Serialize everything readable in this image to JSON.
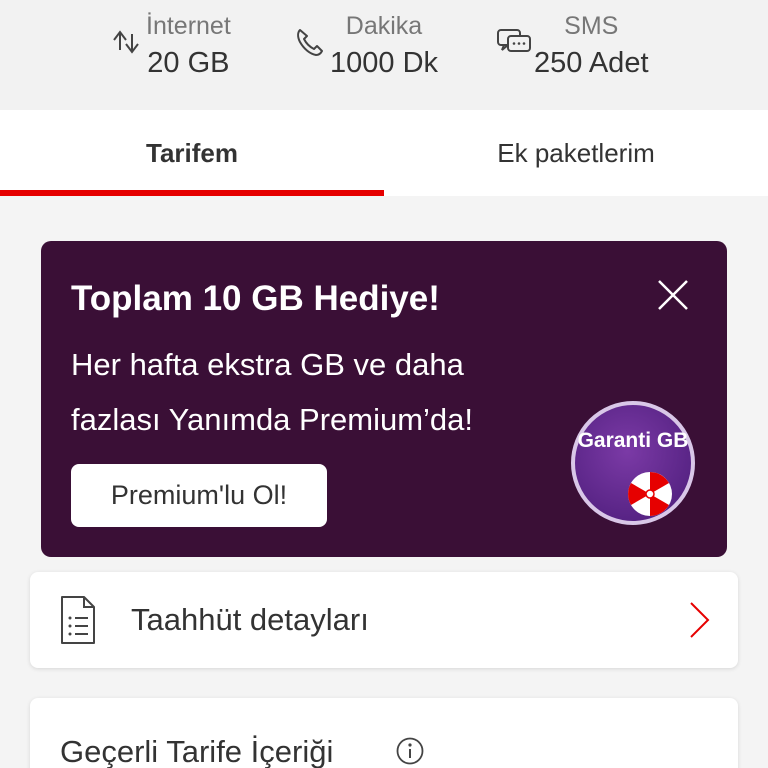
{
  "usage": {
    "internet": {
      "label": "İnternet",
      "value": "20 GB",
      "icon": "data-transfer-icon"
    },
    "dakika": {
      "label": "Dakika",
      "value": "1000 Dk",
      "icon": "phone-icon"
    },
    "sms": {
      "label": "SMS",
      "value": "250 Adet",
      "icon": "chat-icon"
    }
  },
  "tabs": [
    {
      "label": "Tarifem",
      "active": true
    },
    {
      "label": "Ek paketlerim",
      "active": false
    }
  ],
  "promo": {
    "title": "Toplam 10 GB Hediye!",
    "description": "Her hafta ekstra GB ve daha fazlası Yanımda Premium’da!",
    "button_label": "Premium'lu Ol!",
    "badge_text": "Garanti GB",
    "background": "#3a0f36"
  },
  "list": {
    "taahhut_label": "Taahhüt detayları"
  },
  "section": {
    "title": "Geçerli Tarife İçeriği"
  },
  "colors": {
    "accent": "#e60000"
  }
}
